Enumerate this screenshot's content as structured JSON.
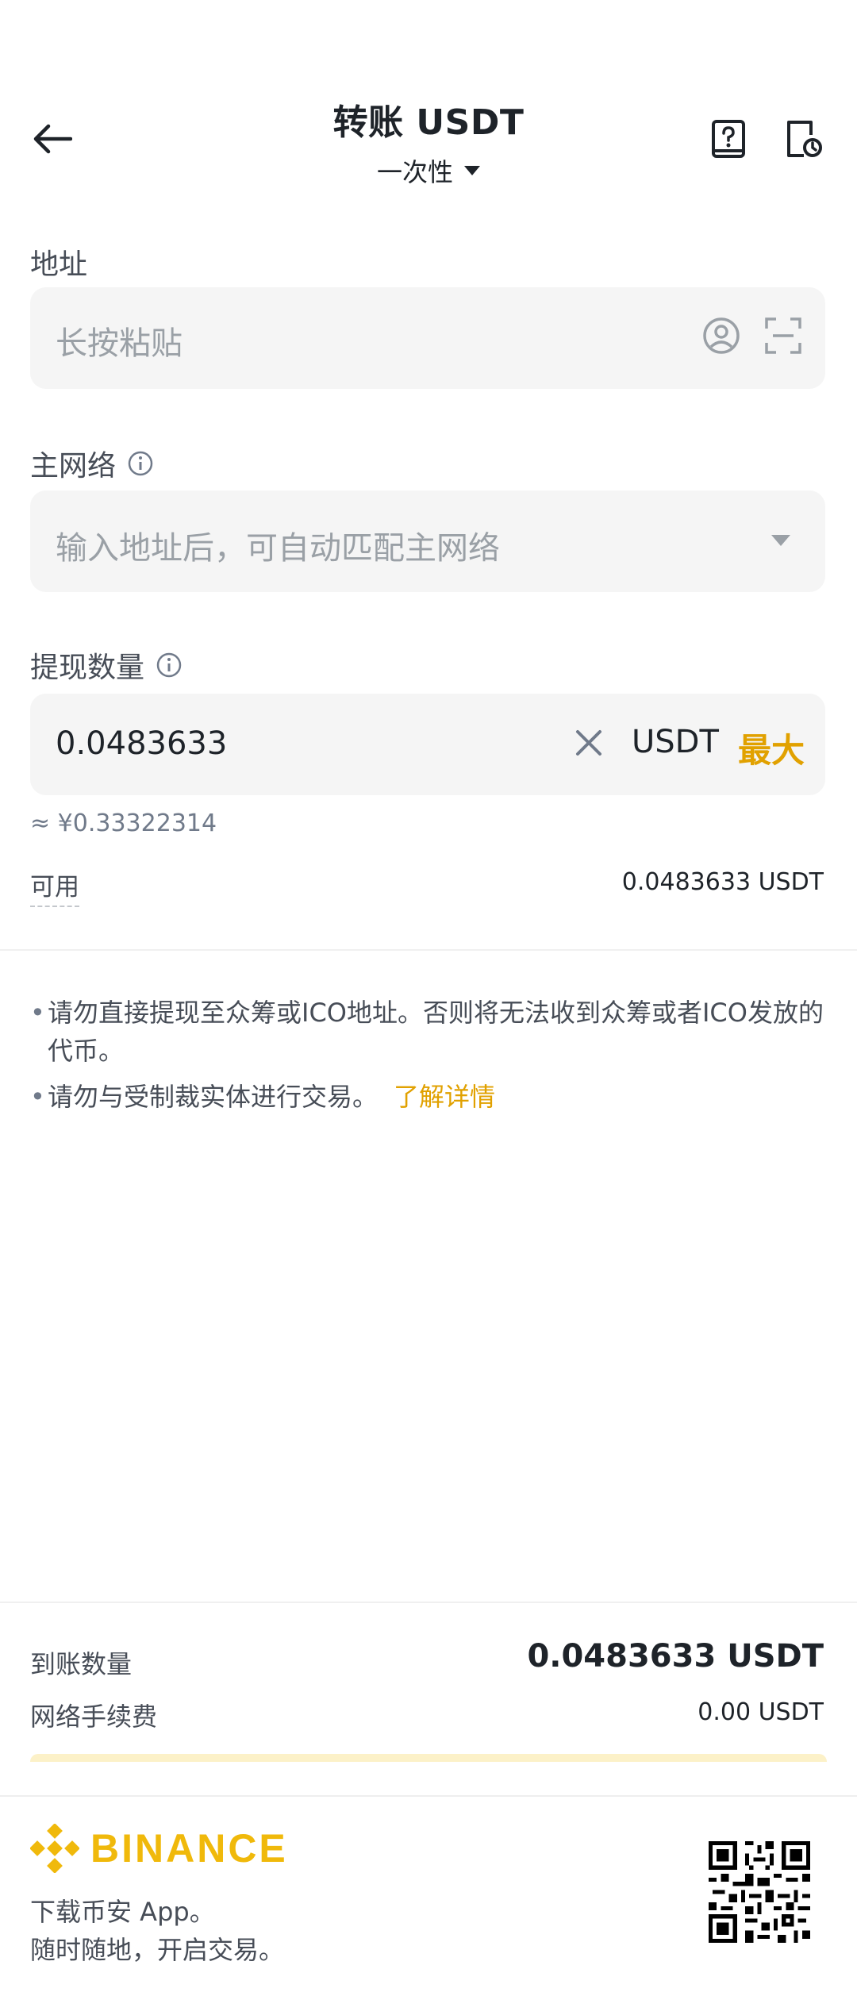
{
  "header": {
    "title": "转账 USDT",
    "mode": "一次性"
  },
  "address": {
    "label": "地址",
    "placeholder": "长按粘贴"
  },
  "network": {
    "label": "主网络",
    "placeholder": "输入地址后，可自动匹配主网络"
  },
  "amount": {
    "label": "提现数量",
    "value": "0.0483633",
    "currency": "USDT",
    "max_label": "最大",
    "approx": "≈ ¥0.33322314",
    "available_label": "可用",
    "available_value": "0.0483633 USDT"
  },
  "notices": [
    "请勿直接提现至众筹或ICO地址。否则将无法收到众筹或者ICO发放的代币。",
    "请勿与受制裁实体进行交易。"
  ],
  "notice_link": "了解详情",
  "summary": {
    "receive_label": "到账数量",
    "receive_value": "0.0483633 USDT",
    "fee_label": "网络手续费",
    "fee_value": "0.00 USDT"
  },
  "footer": {
    "brand": "BINANCE",
    "line1": "下载币安 App。",
    "line2": "随时随地，开启交易。"
  },
  "colors": {
    "accent": "#f0b90b",
    "link": "#e1a100",
    "field_bg": "#f5f5f5"
  }
}
